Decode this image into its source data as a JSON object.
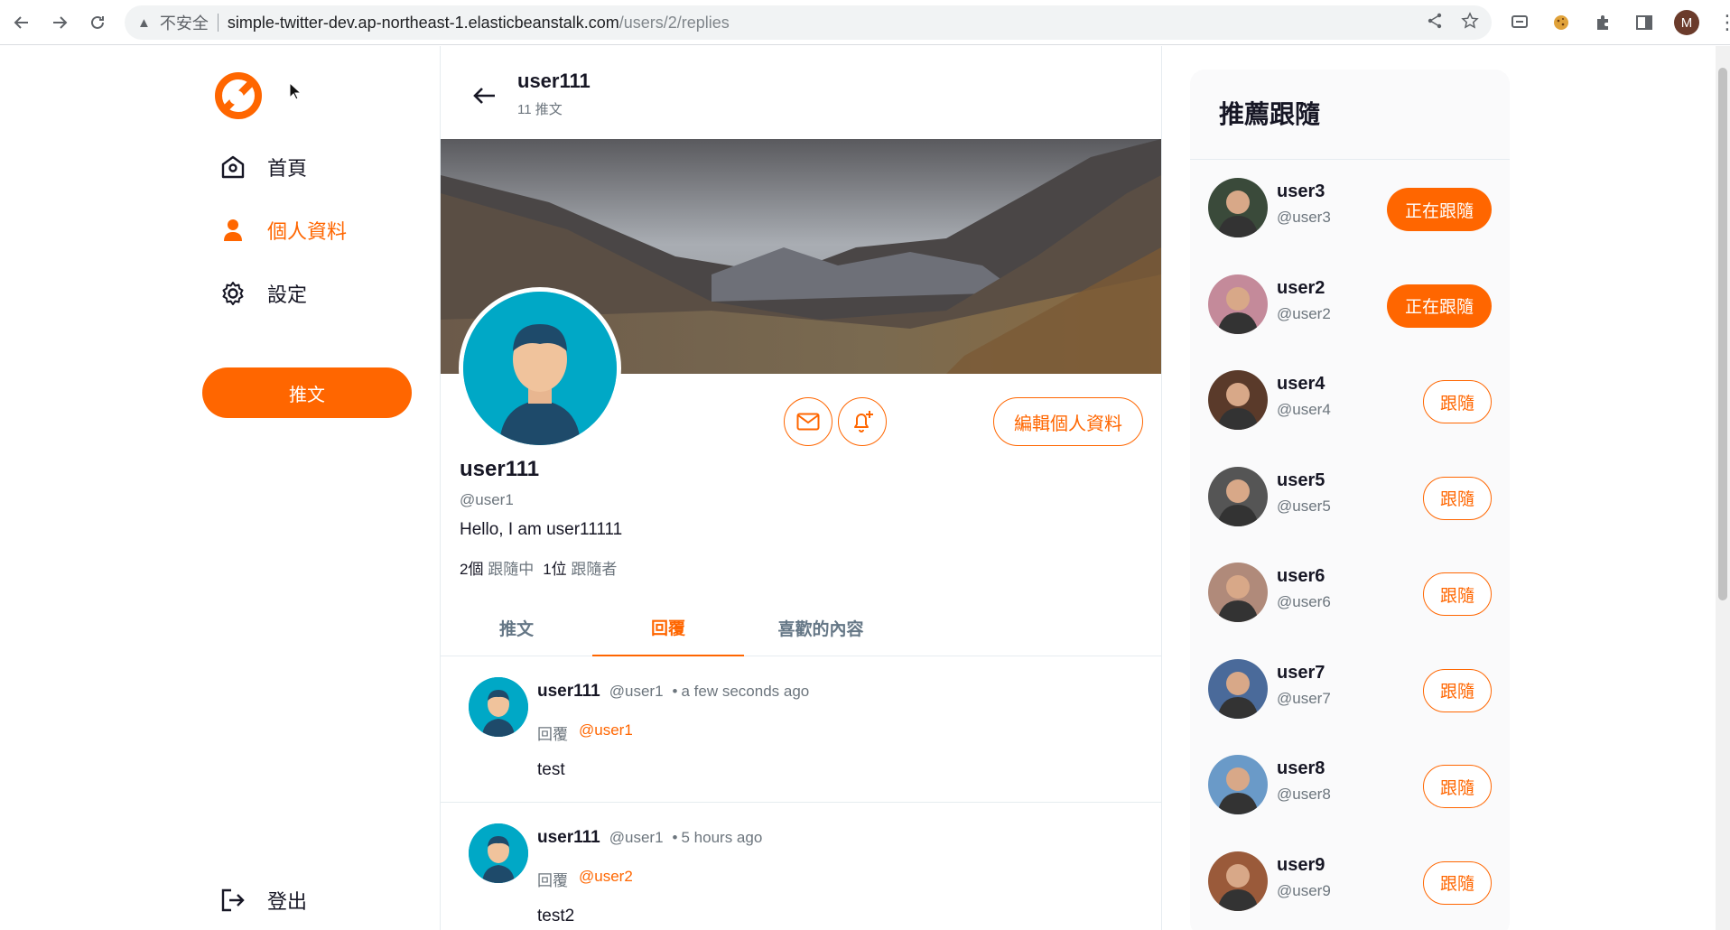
{
  "browser": {
    "insecure_label": "不安全",
    "url_host": "simple-twitter-dev.ap-northeast-1.elasticbeanstalk.com",
    "url_path": "/users/2/replies",
    "profile_initial": "M"
  },
  "sidebar": {
    "items": [
      {
        "label": "首頁",
        "icon": "home-icon"
      },
      {
        "label": "個人資料",
        "icon": "user-icon",
        "active": true
      },
      {
        "label": "設定",
        "icon": "gear-icon"
      }
    ],
    "tweet_button": "推文",
    "logout_label": "登出"
  },
  "header": {
    "name": "user111",
    "tweet_count": "11 推文"
  },
  "profile": {
    "name": "user111",
    "handle": "@user1",
    "bio": "Hello, I am user11111",
    "following_count": "2個",
    "following_label": "跟隨中",
    "followers_count": "1位",
    "followers_label": "跟隨者",
    "edit_button": "編輯個人資料"
  },
  "tabs": [
    {
      "label": "推文"
    },
    {
      "label": "回覆",
      "active": true
    },
    {
      "label": "喜歡的內容"
    }
  ],
  "replies": [
    {
      "name": "user111",
      "handle": "@user1",
      "time": "a few seconds ago",
      "reply_label": "回覆",
      "reply_to": "@user1",
      "body": "test"
    },
    {
      "name": "user111",
      "handle": "@user1",
      "time": "5 hours ago",
      "reply_label": "回覆",
      "reply_to": "@user2",
      "body": "test2"
    }
  ],
  "recommend": {
    "title": "推薦跟隨",
    "users": [
      {
        "name": "user3",
        "handle": "@user3",
        "button": "正在跟隨",
        "following": true,
        "color": "#3a4a3a"
      },
      {
        "name": "user2",
        "handle": "@user2",
        "button": "正在跟隨",
        "following": true,
        "color": "#c48a9a"
      },
      {
        "name": "user4",
        "handle": "@user4",
        "button": "跟隨",
        "following": false,
        "color": "#5a3a2a"
      },
      {
        "name": "user5",
        "handle": "@user5",
        "button": "跟隨",
        "following": false,
        "color": "#555555"
      },
      {
        "name": "user6",
        "handle": "@user6",
        "button": "跟隨",
        "following": false,
        "color": "#b08a7a"
      },
      {
        "name": "user7",
        "handle": "@user7",
        "button": "跟隨",
        "following": false,
        "color": "#4a6a9a"
      },
      {
        "name": "user8",
        "handle": "@user8",
        "button": "跟隨",
        "following": false,
        "color": "#6a9ac8"
      },
      {
        "name": "user9",
        "handle": "@user9",
        "button": "跟隨",
        "following": false,
        "color": "#9a5a3a"
      }
    ]
  },
  "colors": {
    "accent": "#ff6600",
    "avatar_bg": "#00a8c6"
  }
}
